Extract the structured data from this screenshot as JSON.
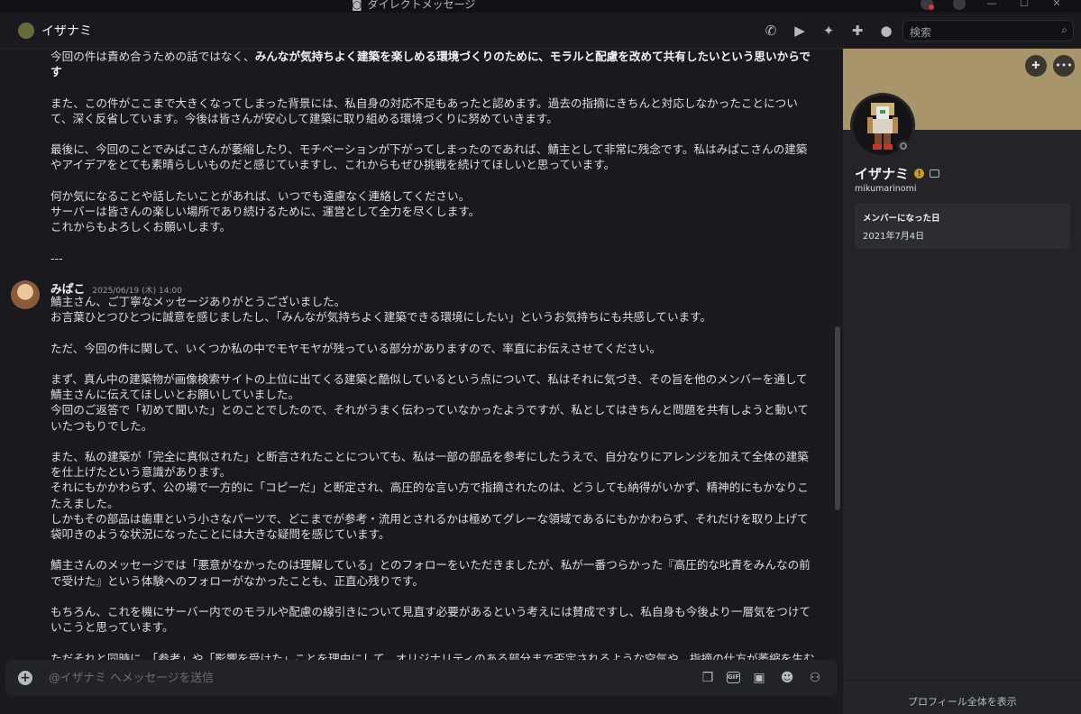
{
  "titlebar": {
    "title": "ダイレクトメッセージ"
  },
  "header": {
    "user_name": "イザナミ",
    "search_placeholder": "検索"
  },
  "messages": {
    "prev_paragraphs": [
      "今回の件は責め合うための話ではなく、",
      "みんなが気持ちよく建築を楽しめる環境づくりのために、モラルと配慮を改めて共有したいという思いからです",
      "また、この件がここまで大きくなってしまった背景には、私自身の対応不足もあったと認めます。過去の指摘にきちんと対応しなかったことについて、深く反省しています。今後は皆さんが安心して建築に取り組める環境づくりに努めていきます。",
      "最後に、今回のことでみぱこさんが萎縮したり、モチベーションが下がってしまったのであれば、鯖主として非常に残念です。私はみぱこさんの建築やアイデアをとても素晴らしいものだと感じていますし、これからもぜひ挑戦を続けてほしいと思っています。",
      "何か気になることや話したいことがあれば、いつでも遠慮なく連絡してください。",
      "サーバーは皆さんの楽しい場所であり続けるために、運営として全力を尽くします。",
      "これからもよろしくお願いします。",
      "---"
    ],
    "author": "みぱこ",
    "timestamp": "2025/06/19 (木) 14:00",
    "reply": [
      "鯖主さん、ご丁寧なメッセージありがとうございました。",
      "お言葉ひとつひとつに誠意を感じましたし、「みんなが気持ちよく建築できる環境にしたい」というお気持ちにも共感しています。",
      "ただ、今回の件に関して、いくつか私の中でモヤモヤが残っている部分がありますので、率直にお伝えさせてください。",
      "まず、真ん中の建築物が画像検索サイトの上位に出てくる建築と酷似しているという点について、私はそれに気づき、その旨を他のメンバーを通して鯖主さんに伝えてほしいとお願いしていました。",
      "今回のご返答で「初めて聞いた」とのことでしたので、それがうまく伝わっていなかったようですが、私としてはきちんと問題を共有しようと動いていたつもりでした。",
      "また、私の建築が「完全に真似された」と断言されたことについても、私は一部の部品を参考にしたうえで、自分なりにアレンジを加えて全体の建築を仕上げたという意識があります。",
      "それにもかかわらず、公の場で一方的に「コピーだ」と断定され、高圧的な言い方で指摘されたのは、どうしても納得がいかず、精神的にもかなりこたえました。",
      "しかもその部品は歯車という小さなパーツで、どこまでが参考・流用とされるかは極めてグレーな領域であるにもかかわらず、それだけを取り上げて袋叩きのような状況になったことには大きな疑問を感じています。",
      "鯖主さんのメッセージでは「悪意がなかったのは理解している」とのフォローをいただきましたが、私が一番つらかった『高圧的な叱責をみんなの前で受けた』という体験へのフォローがなかったことも、正直心残りです。",
      "もちろん、これを機にサーバー内でのモラルや配慮の線引きについて見直す必要があるという考えには賛成ですし、私自身も今後より一層気をつけていこうと思っています。",
      "ただそれと同時に、「参考」や「影響を受けた」ことを理由にして、オリジナリティのある部分まで否定されるような空気や、指摘の仕方が萎縮を生む"
    ]
  },
  "composer": {
    "placeholder": "@イザナミ へメッセージを送信"
  },
  "profile": {
    "display_name": "イザナミ",
    "username": "mikumarinomi",
    "member_since_label": "メンバーになった日",
    "member_since_value": "2021年7月4日",
    "footer_link": "プロフィール全体を表示",
    "banner_color": "#a8956c"
  }
}
